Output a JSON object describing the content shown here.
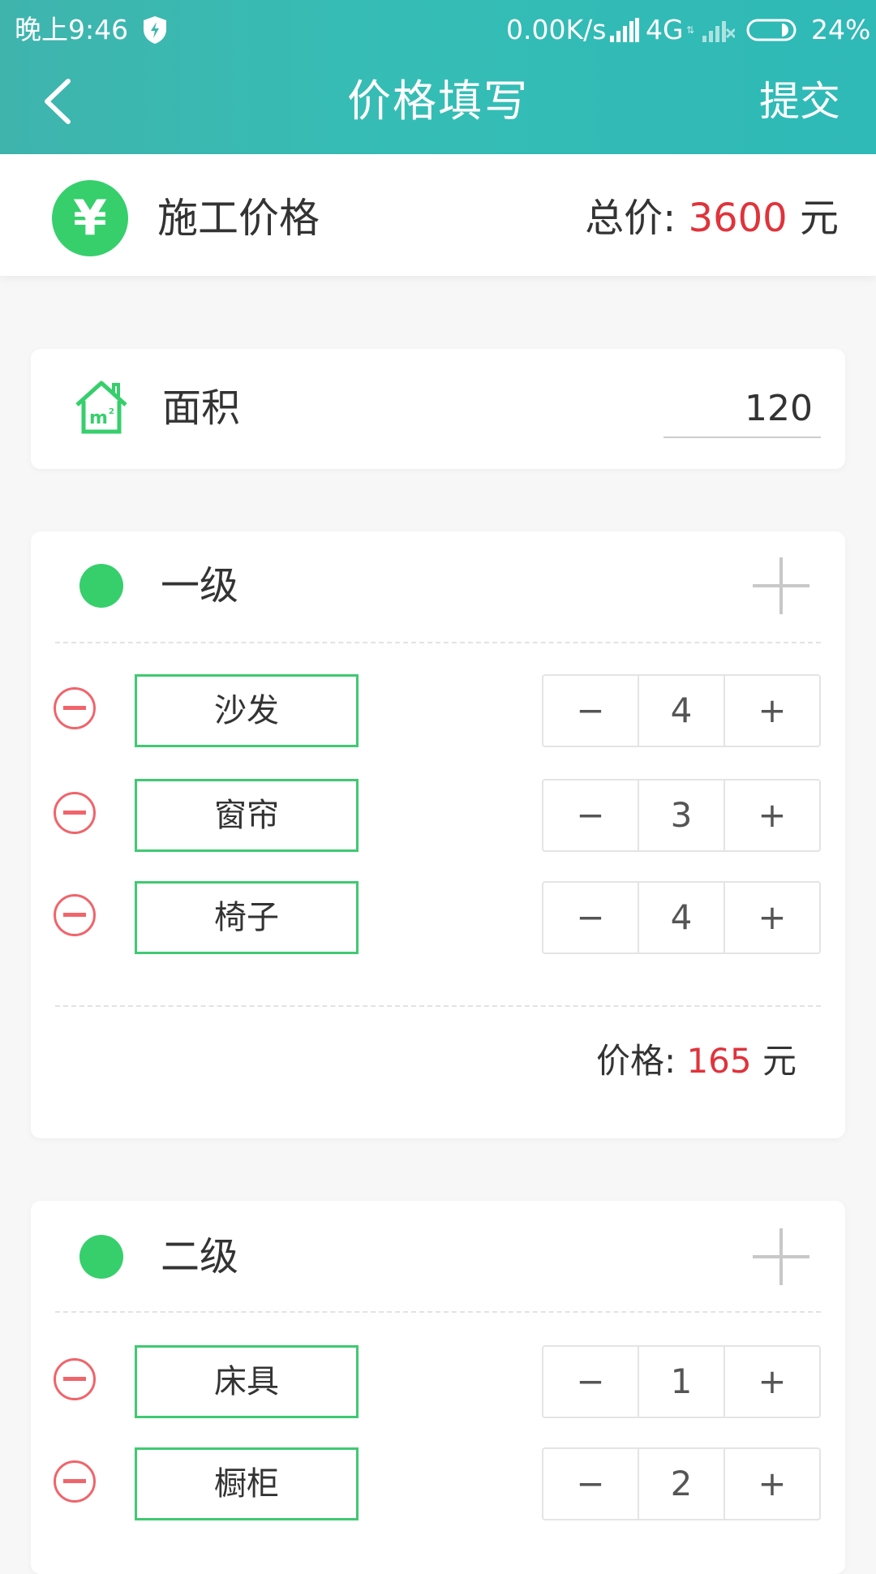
{
  "status_bar": {
    "time": "晚上9:46",
    "speed": "0.00K/s",
    "network": "4G",
    "battery": "24%"
  },
  "nav": {
    "title": "价格填写",
    "submit": "提交"
  },
  "summary": {
    "label": "施工价格",
    "total_label": "总价:",
    "total_value": "3600",
    "unit": "元"
  },
  "area": {
    "label": "面积",
    "value": "120"
  },
  "levels": [
    {
      "title": "一级",
      "items": [
        {
          "name": "沙发",
          "qty": "4"
        },
        {
          "name": "窗帘",
          "qty": "3"
        },
        {
          "name": "椅子",
          "qty": "4"
        }
      ],
      "price_label": "价格:",
      "price_value": "165",
      "unit": "元"
    },
    {
      "title": "二级",
      "items": [
        {
          "name": "床具",
          "qty": "1"
        },
        {
          "name": "橱柜",
          "qty": "2"
        }
      ]
    }
  ],
  "stepper": {
    "minus": "−",
    "plus": "+"
  },
  "colors": {
    "header_gradient_start": "#3fb4ad",
    "header_gradient_end": "#2fb9b7",
    "accent_green": "#36cf6c",
    "price_red": "#e0333b",
    "remove_red": "#f0646b"
  },
  "icons": {
    "yen": "¥"
  }
}
